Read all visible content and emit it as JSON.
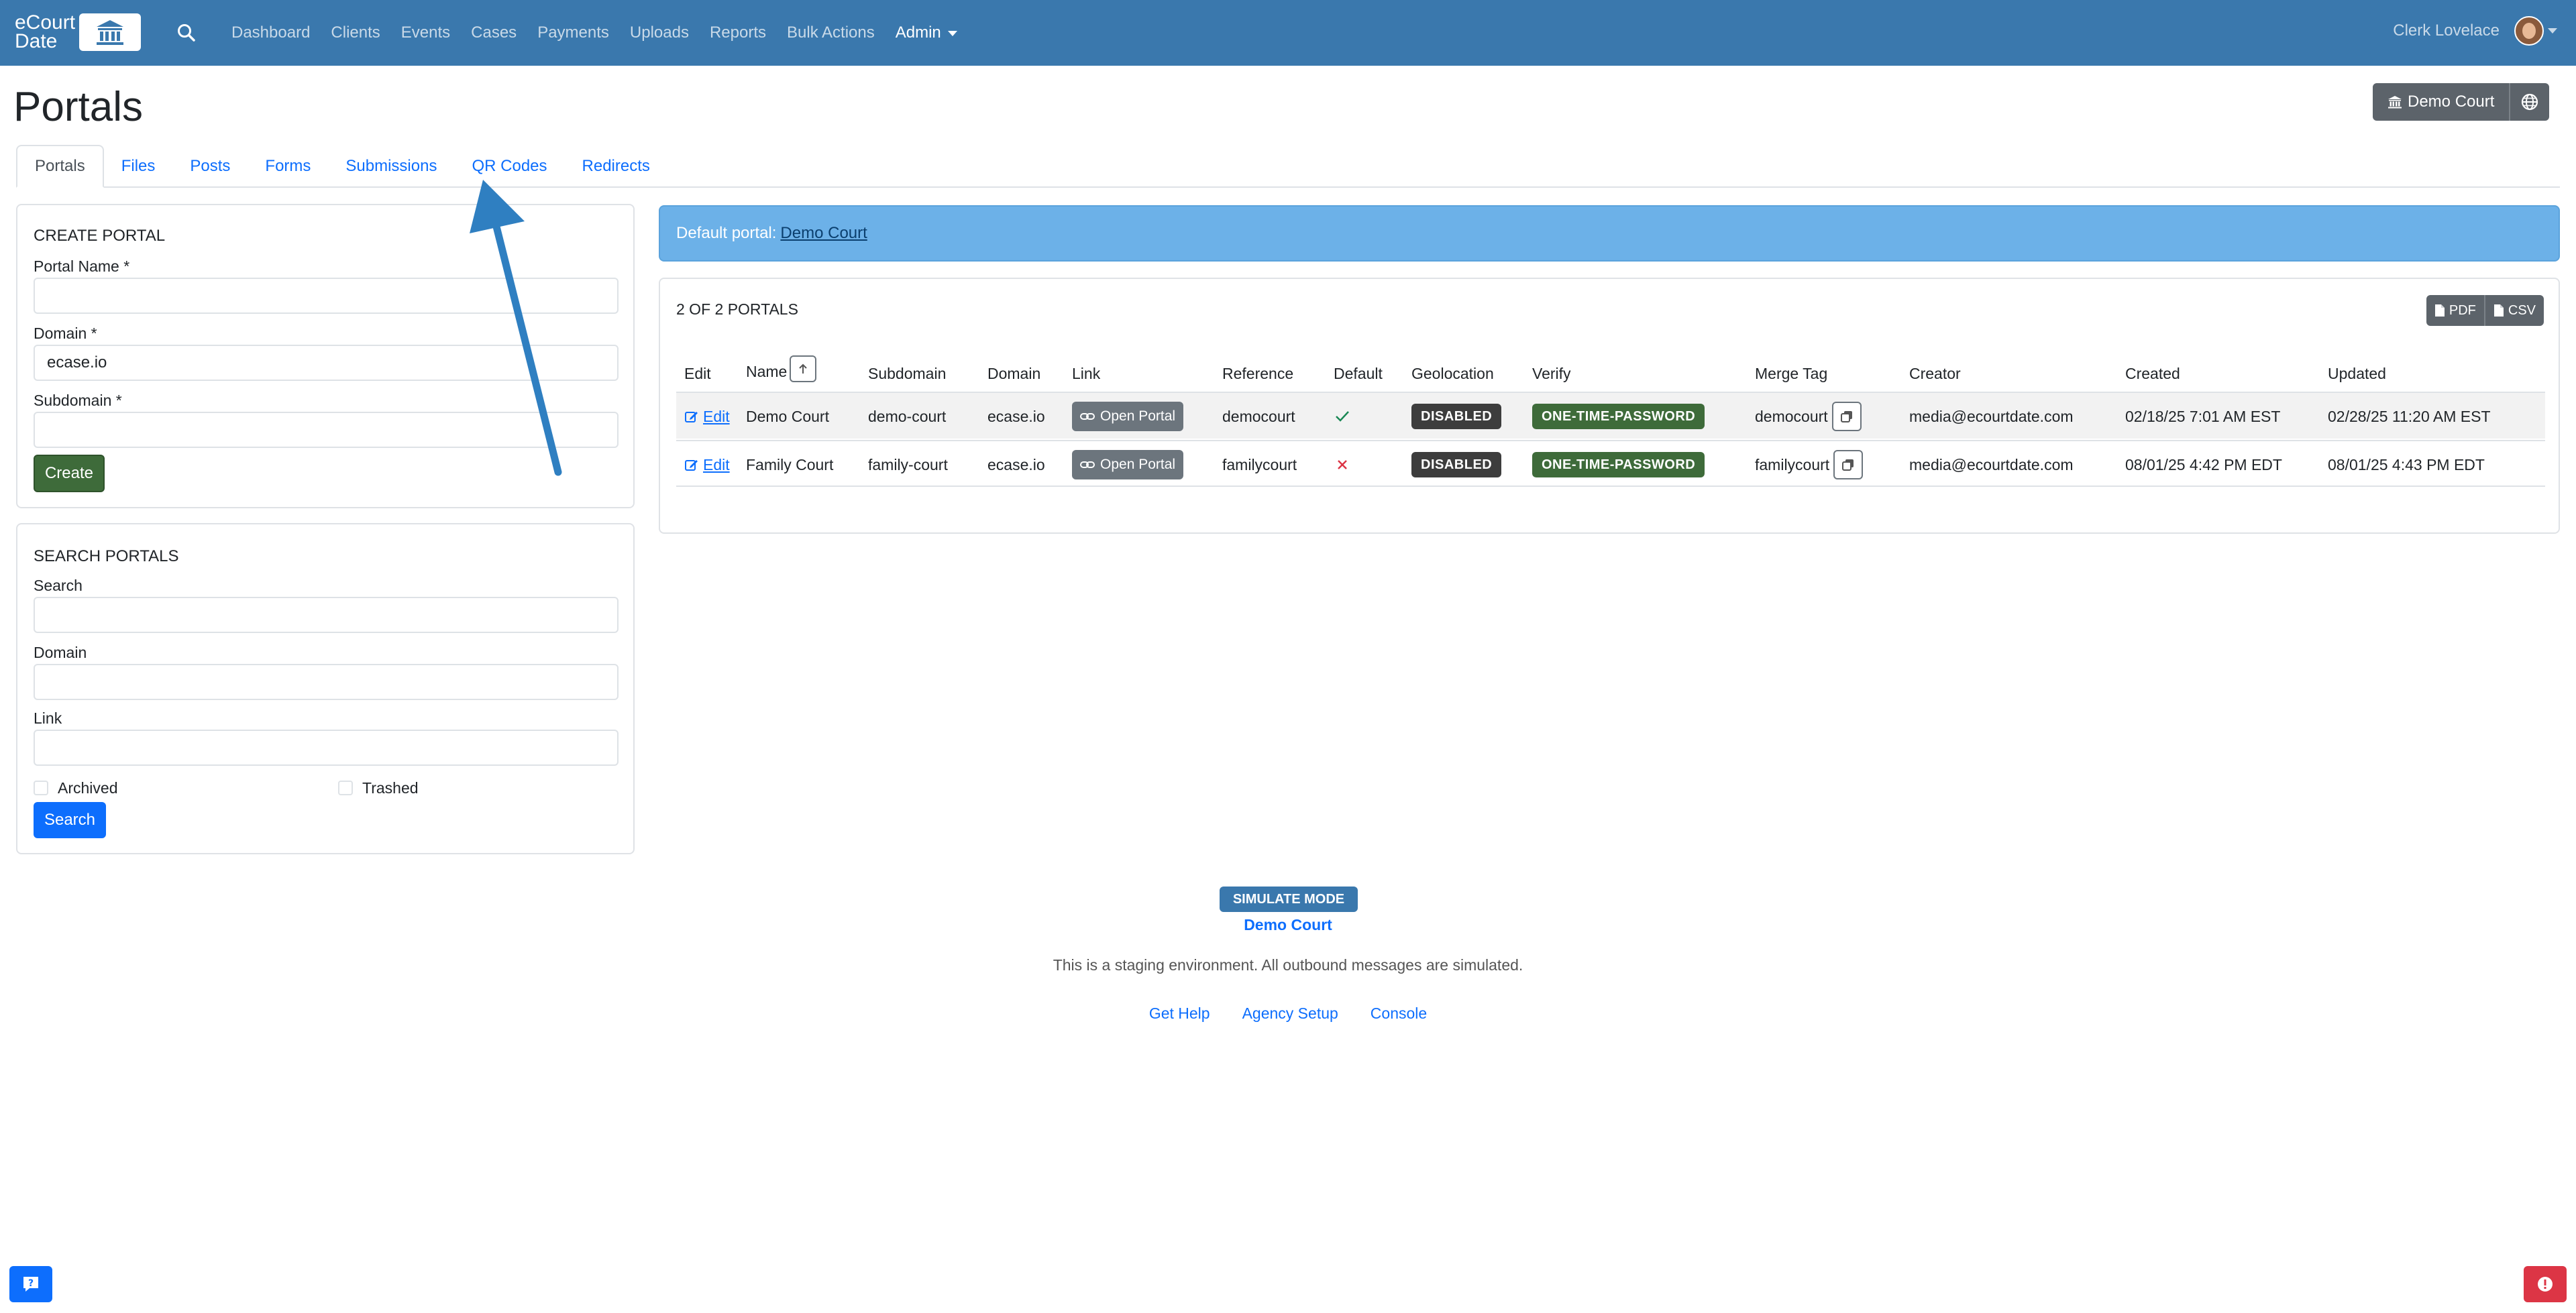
{
  "navbar": {
    "brand_line1": "eCourt",
    "brand_line2": "Date",
    "links": [
      "Dashboard",
      "Clients",
      "Events",
      "Cases",
      "Payments",
      "Uploads",
      "Reports",
      "Bulk Actions"
    ],
    "admin_label": "Admin",
    "user_name": "Clerk Lovelace"
  },
  "header": {
    "title": "Portals",
    "court_button": "Demo Court"
  },
  "tabs": [
    "Portals",
    "Files",
    "Posts",
    "Forms",
    "Submissions",
    "QR Codes",
    "Redirects"
  ],
  "create_portal": {
    "title": "CREATE PORTAL",
    "portal_name_label": "Portal Name *",
    "portal_name_value": "",
    "domain_label": "Domain *",
    "domain_value": "ecase.io",
    "subdomain_label": "Subdomain *",
    "subdomain_value": "",
    "create_button": "Create"
  },
  "search_portals": {
    "title": "SEARCH PORTALS",
    "search_label": "Search",
    "domain_label": "Domain",
    "link_label": "Link",
    "archived_label": "Archived",
    "trashed_label": "Trashed",
    "search_button": "Search"
  },
  "alert": {
    "prefix": "Default portal:",
    "link": "Demo Court"
  },
  "table": {
    "count": "2 OF 2 PORTALS",
    "pdf_label": "PDF",
    "csv_label": "CSV",
    "headers": [
      "Edit",
      "Name",
      "Subdomain",
      "Domain",
      "Link",
      "Reference",
      "Default",
      "Geolocation",
      "Verify",
      "Merge Tag",
      "Creator",
      "Created",
      "Updated"
    ],
    "edit_label": "Edit",
    "open_label": "Open Portal",
    "rows": [
      {
        "name": "Demo Court",
        "subdomain": "demo-court",
        "domain": "ecase.io",
        "reference": "democourt",
        "default": true,
        "geolocation": "DISABLED",
        "verify": "ONE-TIME-PASSWORD",
        "merge_tag": "democourt",
        "creator": "media@ecourtdate.com",
        "created": "02/18/25 7:01 AM EST",
        "updated": "02/28/25 11:20 AM EST"
      },
      {
        "name": "Family Court",
        "subdomain": "family-court",
        "domain": "ecase.io",
        "reference": "familycourt",
        "default": false,
        "geolocation": "DISABLED",
        "verify": "ONE-TIME-PASSWORD",
        "merge_tag": "familycourt",
        "creator": "media@ecourtdate.com",
        "created": "08/01/25 4:42 PM EDT",
        "updated": "08/01/25 4:43 PM EDT"
      }
    ]
  },
  "footer": {
    "simulate_badge": "SIMULATE MODE",
    "court": "Demo Court",
    "staging_text": "This is a staging environment. All outbound messages are simulated.",
    "links": [
      "Get Help",
      "Agency Setup",
      "Console"
    ]
  },
  "colors": {
    "navbar": "#3a78ad",
    "primary": "#0d6efd",
    "success": "#3e6b3a",
    "alert_bg": "#6cb1e8",
    "annotation_arrow": "#2f7fc1"
  }
}
